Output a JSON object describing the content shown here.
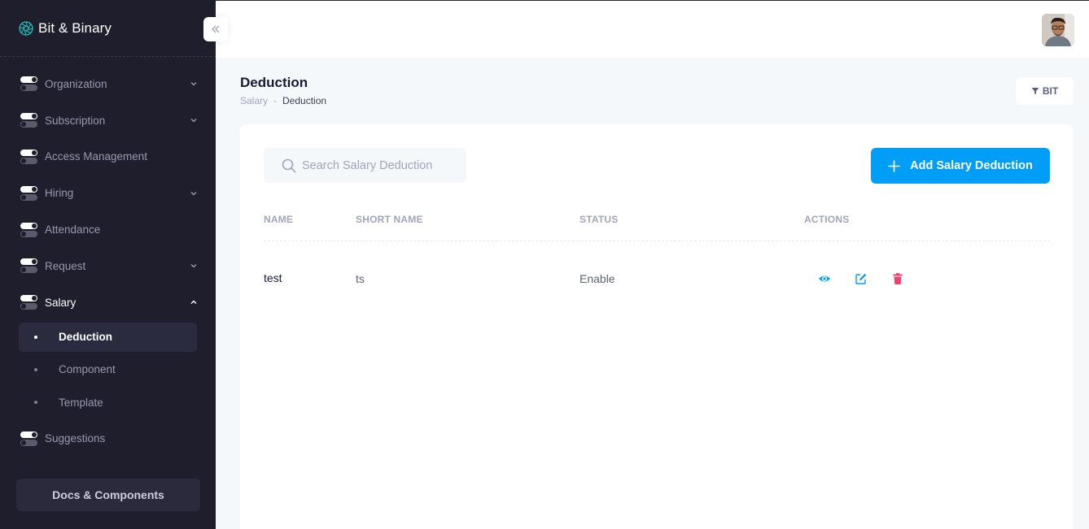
{
  "brand": {
    "name": "Bit & Binary"
  },
  "sidebar": {
    "items": [
      {
        "label": "Organization",
        "has_chevron": true
      },
      {
        "label": "Subscription",
        "has_chevron": true
      },
      {
        "label": "Access Management",
        "has_chevron": false
      },
      {
        "label": "Hiring",
        "has_chevron": true
      },
      {
        "label": "Attendance",
        "has_chevron": false
      },
      {
        "label": "Request",
        "has_chevron": true
      },
      {
        "label": "Salary",
        "has_chevron": true,
        "expanded": true
      }
    ],
    "salary_sub": [
      {
        "label": "Deduction",
        "active": true
      },
      {
        "label": "Component",
        "active": false
      },
      {
        "label": "Template",
        "active": false
      }
    ],
    "suggestions": {
      "label": "Suggestions"
    },
    "docs_button": "Docs & Components"
  },
  "toolbar": {
    "title": "Deduction",
    "breadcrumb": {
      "parent": "Salary",
      "separator": "-",
      "current": "Deduction"
    },
    "filter_label": "BIT"
  },
  "card": {
    "search_placeholder": "Search Salary Deduction",
    "add_button": "Add Salary Deduction",
    "columns": {
      "name": "NAME",
      "short_name": "SHORT NAME",
      "status": "STATUS",
      "actions": "ACTIONS"
    },
    "rows": [
      {
        "name": "test",
        "short_name": "ts",
        "status": "Enable"
      }
    ]
  },
  "colors": {
    "sidebar_bg": "#1e1e2d",
    "primary": "#009ef7",
    "danger": "#f1416c",
    "page_bg": "#f5f8fa"
  },
  "icons": {
    "brand": "aperture-logo-icon",
    "collapse": "double-chevron-left-icon",
    "menu": "toggle-icon",
    "search": "search-icon",
    "add": "plus-icon",
    "filter": "filter-icon",
    "view": "eye-icon",
    "edit": "edit-icon",
    "delete": "trash-icon"
  }
}
